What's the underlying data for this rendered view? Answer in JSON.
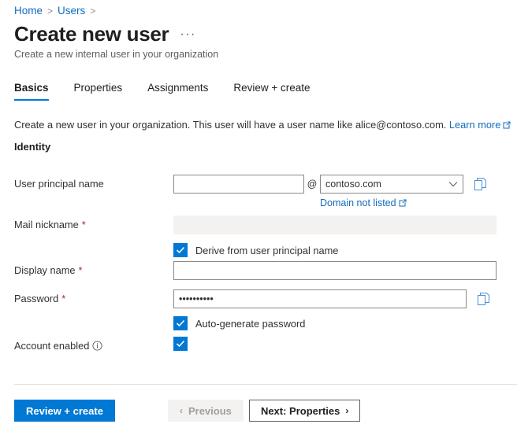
{
  "breadcrumb": {
    "items": [
      {
        "label": "Home"
      },
      {
        "label": "Users"
      }
    ],
    "separator": ">"
  },
  "header": {
    "title": "Create new user",
    "subtitle": "Create a new internal user in your organization",
    "more_menu": "···"
  },
  "tabs": [
    {
      "label": "Basics",
      "active": true
    },
    {
      "label": "Properties",
      "active": false
    },
    {
      "label": "Assignments",
      "active": false
    },
    {
      "label": "Review + create",
      "active": false
    }
  ],
  "description": {
    "text": "Create a new user in your organization. This user will have a user name like alice@contoso.com.",
    "link_label": "Learn more"
  },
  "section": {
    "identity_title": "Identity"
  },
  "form": {
    "user_principal_name": {
      "label": "User principal name",
      "value": "",
      "at": "@",
      "domain_value": "contoso.com",
      "chevron": "∨",
      "sublink_label": "Domain not listed"
    },
    "mail_nickname": {
      "label": "Mail nickname",
      "required": "*",
      "value": "",
      "checkbox_label": "Derive from user principal name",
      "checkbox_checked": true
    },
    "display_name": {
      "label": "Display name",
      "required": "*",
      "value": ""
    },
    "password": {
      "label": "Password",
      "required": "*",
      "value": "••••••••••",
      "checkbox_label": "Auto-generate password",
      "checkbox_checked": true
    },
    "account_enabled": {
      "label": "Account enabled",
      "checked": true
    }
  },
  "footer": {
    "review_create": "Review + create",
    "previous": "Previous",
    "previous_arrow": "‹",
    "next": "Next: Properties",
    "next_arrow": "›"
  },
  "colors": {
    "accent": "#0078d4",
    "link": "#0f6cbd",
    "required": "#a4262c",
    "disabled_bg": "#f3f2f1"
  }
}
